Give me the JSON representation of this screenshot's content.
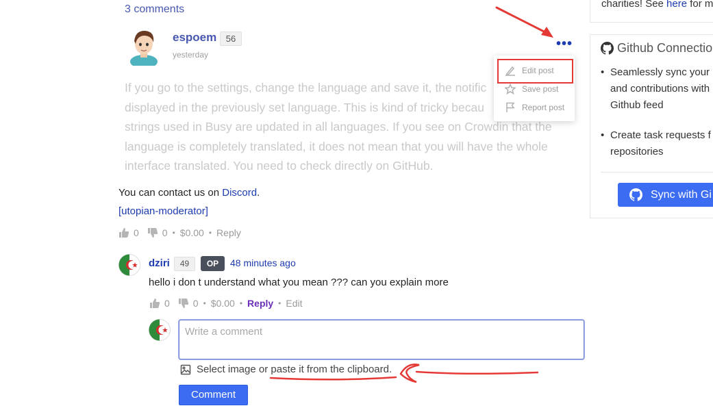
{
  "comments": {
    "count_label": "3 comments"
  },
  "post": {
    "author": "espoem",
    "reputation": "56",
    "time": "yesterday",
    "body_lines": [
      "If you go to the settings, change the language and save it, the notific",
      "displayed in the previously set language. This is kind of tricky becau",
      "strings used in Busy are updated in all languages. If you see on Crowdin that the",
      "language is completely translated, it does not mean that you will have the whole",
      "interface translated. You need to check directly on GitHub."
    ],
    "contact_prefix": "You can contact us on ",
    "contact_link": "Discord",
    "contact_suffix": ".",
    "tag": "[utopian-moderator]",
    "upvotes": "0",
    "downvotes": "0",
    "payout": "$0.00",
    "reply_label": "Reply"
  },
  "menu": {
    "dots": "•••",
    "items": [
      {
        "label": "Edit post",
        "icon": "edit-icon"
      },
      {
        "label": "Save post",
        "icon": "star-icon"
      },
      {
        "label": "Report post",
        "icon": "flag-icon"
      }
    ]
  },
  "reply": {
    "author": "dziri",
    "reputation": "49",
    "op_badge": "OP",
    "time": "48 minutes ago",
    "body": "hello i don t understand what you mean ??? can you explain more",
    "upvotes": "0",
    "downvotes": "0",
    "payout": "$0.00",
    "reply_label": "Reply",
    "edit_label": "Edit"
  },
  "form": {
    "placeholder": "Write a comment",
    "image_hint": "Select image or paste it from the clipboard.",
    "submit_label": "Comment"
  },
  "sidebar": {
    "top_text_prefix": "charities! See ",
    "top_link": "here",
    "top_text_suffix": " for m",
    "github_title": "Github Connectio",
    "features": [
      {
        "line1": "Seamlessly sync your",
        "line2": "and contributions with",
        "line3": "Github feed"
      },
      {
        "line1": "Create task requests f",
        "line2": "repositories",
        "line3": ""
      }
    ],
    "sync_label": "Sync with Gi"
  },
  "colors": {
    "accent": "#3b6cf2",
    "link": "#1d3bb0",
    "annotation_red": "#e53935"
  }
}
